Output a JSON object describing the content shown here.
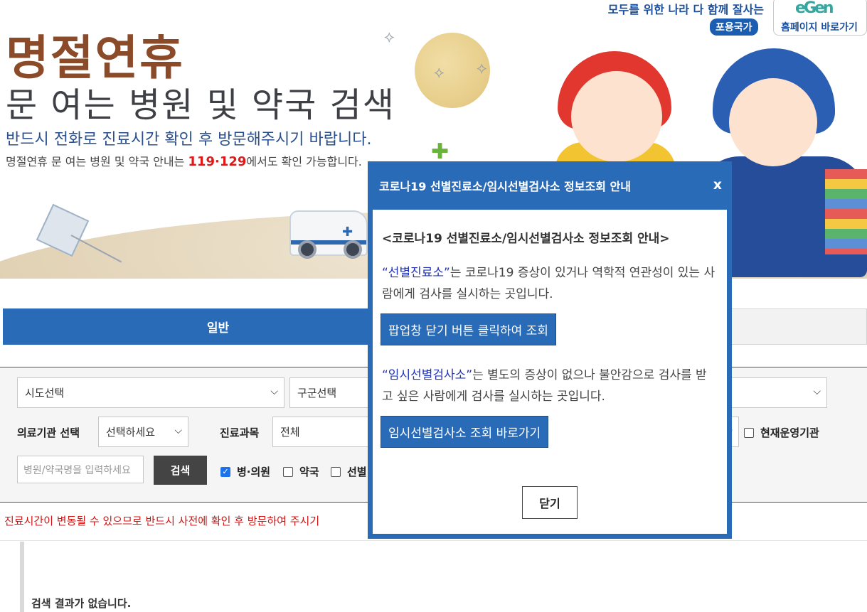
{
  "banner": {
    "title_main": "명절연휴",
    "title_sub": "문 여는 병원 및 약국 검색",
    "subtitle": "반드시 전화로 진료시간 확인 후 방문해주시기 바랍니다.",
    "info_prefix": "명절연휴 문 여는 병원 및 약국 안내는 ",
    "info_numbers": "119·129",
    "info_suffix": "에서도 확인 가능합니다.",
    "slogan": "모두를 위한 나라 다 함께 잘사는",
    "slogan_badge": "포용국가",
    "homepage_link": "홈페이지 바로가기",
    "logo_text": "eGen"
  },
  "tabs": [
    {
      "label": "일반",
      "active": true
    },
    {
      "label": "",
      "active": false
    }
  ],
  "search": {
    "sido_select": "시도선택",
    "gugun_select": "구군선택",
    "institution_label": "의료기관 선택",
    "institution_select": "선택하세요",
    "dept_label": "진료과목",
    "dept_select": "전체",
    "operating_label": "현재운영기관",
    "name_placeholder": "병원/약국명을 입력하세요",
    "search_button": "검색",
    "checkbox_hospital": "병·의원",
    "checkbox_pharmacy": "약국",
    "checkbox_screening": "선별"
  },
  "notice": "진료시간이 변동될 수 있으므로 반드시 사전에 확인 후 방문하여 주시기",
  "results": {
    "empty_message": "검색 결과가 없습니다."
  },
  "modal": {
    "header_title": "코로나19 선별진료소/임시선별검사소 정보조회 안내",
    "close_x": "x",
    "body_title": "<코로나19 선별진료소/임시선별검사소 정보조회 안내>",
    "para1_highlight": "“선별진료소”",
    "para1_text": "는 코로나19 증상이 있거나 역학적 연관성이 있는 사람에게 검사를 실시하는 곳입니다.",
    "button1": "팝업창 닫기 버튼 클릭하여 조회",
    "para2_highlight": "“임시선별검사소”",
    "para2_text": "는 별도의 증상이 없으나 불안감으로 검사를 받고 싶은 사람에게 검사를 실시하는 곳입니다.",
    "button2": "임시선별검사소 조회 바로가기",
    "close_button": "닫기"
  },
  "colors": {
    "accent_blue": "#2a6bb7",
    "notice_red": "#d01414",
    "title_brown": "#8b4a28"
  }
}
